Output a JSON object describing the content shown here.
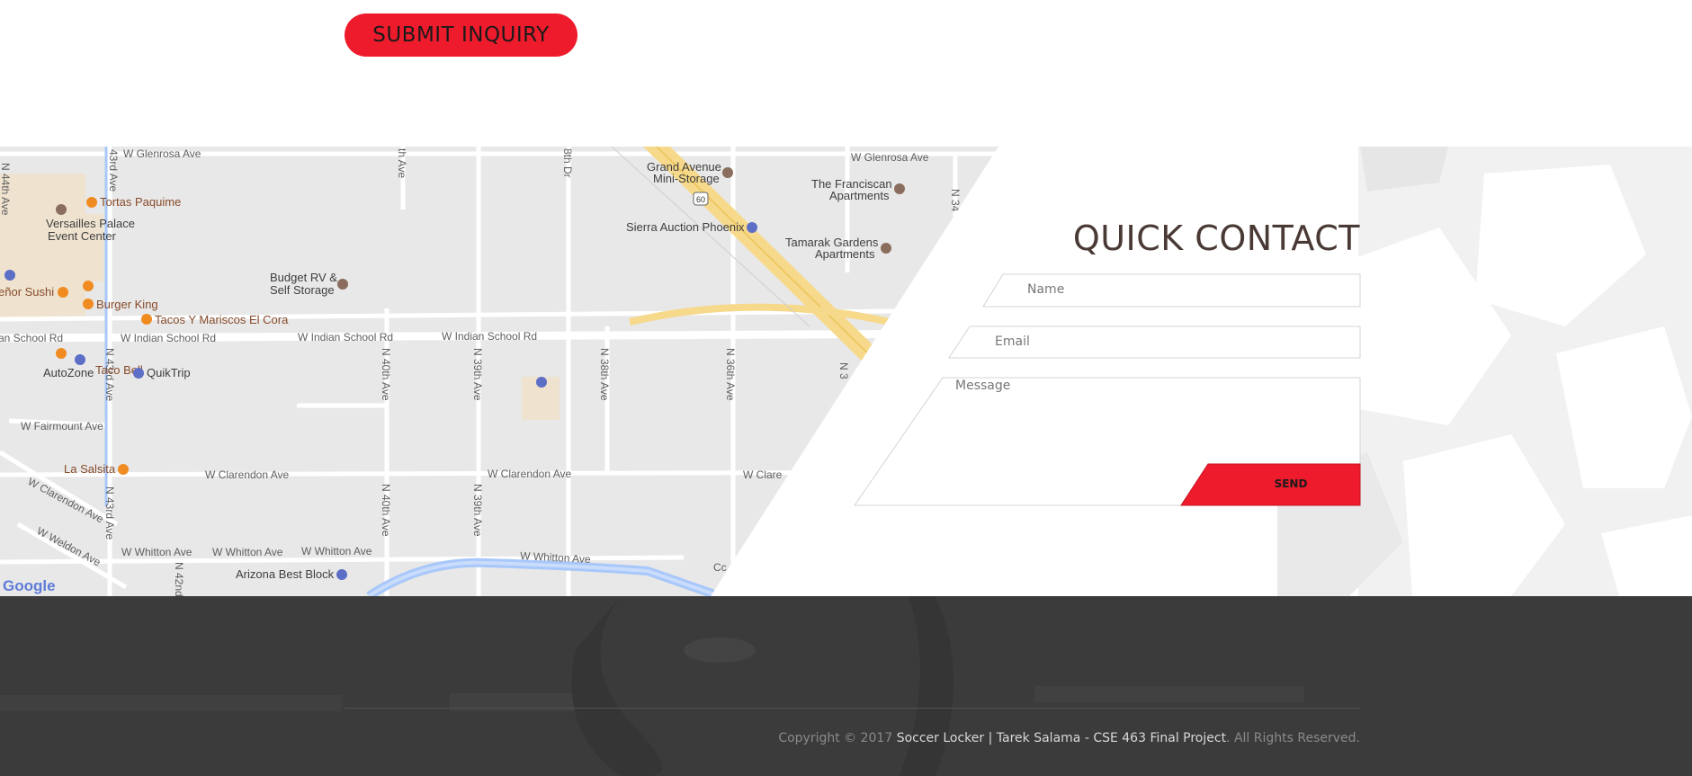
{
  "top": {
    "submit_label": "SUBMIT INQUIRY"
  },
  "contact": {
    "title": "QUICK CONTACT",
    "name_placeholder": "Name",
    "email_placeholder": "Email",
    "message_placeholder": "Message",
    "send_label": "SEND"
  },
  "map": {
    "streets": [
      "W Glenrosa Ave",
      "W Glenrosa Ave",
      "W Indian School Rd",
      "W Indian School Rd",
      "W Indian School Rd",
      "an School Rd",
      "W Fairmount Ave",
      "W Clarendon Ave",
      "W Clarendon Ave",
      "W Clare",
      "W Clarendon Ave",
      "W Weldon Ave",
      "W Whitton Ave",
      "W Whitton Ave",
      "W Whitton Ave",
      "W Whitton Ave",
      "N 44th Ave",
      "43rd Ave",
      "N 43rd Ave",
      "N 43rd Ave",
      "N 42nd",
      "N 40th Ave",
      "N 40th Ave",
      "N 39th Ave",
      "N 39th Ave",
      "N 38th Ave",
      "N 36th Ave",
      "N 3",
      "N 34",
      "th Ave",
      "8th Dr",
      "Cc"
    ],
    "places": [
      "Tortas Paquime",
      "Versailles Palace",
      "Event Center",
      "Taco Bell",
      "eñor Sushi",
      "Burger King",
      "Tacos Y Mariscos El Cora",
      "Budget RV &",
      "Self Storage",
      "AutoZone",
      "QuikTrip",
      "La Salsita",
      "Arizona Best Block",
      "Grand Avenue",
      "Mini-Storage",
      "Sierra Auction Phoenix",
      "The Franciscan",
      "Apartments",
      "Tamarak Gardens",
      "Apartments"
    ],
    "highway_shield": "60",
    "attribution": "Google"
  },
  "footer": {
    "copyright_prefix": "Copyright © 2017 ",
    "copyright_owner": "Soccer Locker | Tarek Salama - CSE 463 Final Project",
    "copyright_suffix": ". All Rights Reserved."
  },
  "colors": {
    "accent": "#ee1b2c",
    "map_bg": "#e8e8e8",
    "footer_bg": "#3b3b3b",
    "title": "#4a3a35"
  }
}
